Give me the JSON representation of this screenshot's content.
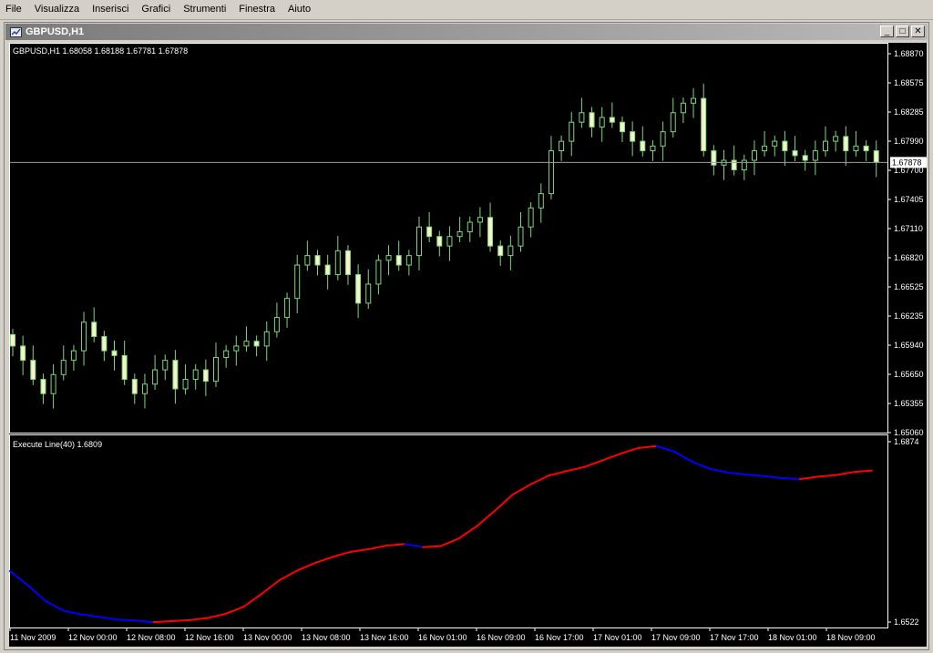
{
  "menu": [
    "File",
    "Visualizza",
    "Inserisci",
    "Grafici",
    "Strumenti",
    "Finestra",
    "Aiuto"
  ],
  "window": {
    "title": "GBPUSD,H1",
    "buttons": {
      "minimize": "_",
      "maximize": "□",
      "close": "✕"
    }
  },
  "chart_data": [
    {
      "type": "candlestick",
      "title": "GBPUSD,H1 1.68058 1.68188 1.67781 1.67878",
      "symbol": "GBPUSD,H1",
      "ohlc_label": "1.68058 1.68188 1.67781 1.67878",
      "ylim": [
        1.6506,
        1.69
      ],
      "y_ticks": [
        "1.68870",
        "1.68575",
        "1.68285",
        "1.67990",
        "1.67700",
        "1.67405",
        "1.67110",
        "1.66820",
        "1.66525",
        "1.66235",
        "1.65940",
        "1.65650",
        "1.65355",
        "1.65060"
      ],
      "current_price": "1.67878",
      "current_price_value": 1.67878,
      "grid": false,
      "colors": {
        "background": "#000000",
        "candle": "#7fd67f",
        "bull_body": "#000000",
        "bear_body": "#f4f4c8",
        "axis": "#ffffff",
        "price_line": "#a0a0a0"
      },
      "x_ticks": [
        "11 Nov 2009",
        "12 Nov 00:00",
        "12 Nov 08:00",
        "12 Nov 16:00",
        "13 Nov 00:00",
        "13 Nov 08:00",
        "13 Nov 16:00",
        "16 Nov 01:00",
        "16 Nov 09:00",
        "16 Nov 17:00",
        "17 Nov 01:00",
        "17 Nov 09:00",
        "17 Nov 17:00",
        "18 Nov 01:00",
        "18 Nov 09:00"
      ],
      "closes": [
        1.6595,
        1.658,
        1.656,
        1.6545,
        1.6565,
        1.658,
        1.659,
        1.662,
        1.6605,
        1.659,
        1.6585,
        1.656,
        1.6545,
        1.6555,
        1.657,
        1.658,
        1.655,
        1.656,
        1.657,
        1.6558,
        1.6583,
        1.659,
        1.6595,
        1.66,
        1.6595,
        1.661,
        1.6625,
        1.6645,
        1.668,
        1.669,
        1.668,
        1.667,
        1.6695,
        1.667,
        1.664,
        1.666,
        1.6685,
        1.669,
        1.668,
        1.669,
        1.672,
        1.671,
        1.67,
        1.671,
        1.6715,
        1.6725,
        1.673,
        1.67,
        1.669,
        1.67,
        1.672,
        1.674,
        1.6755,
        1.68,
        1.681,
        1.683,
        1.684,
        1.6825,
        1.6835,
        1.683,
        1.682,
        1.681,
        1.68,
        1.6805,
        1.682,
        1.684,
        1.685,
        1.6855,
        1.68,
        1.6785,
        1.679,
        1.678,
        1.679,
        1.68,
        1.6805,
        1.681,
        1.68,
        1.6795,
        1.679,
        1.68,
        1.681,
        1.6815,
        1.68,
        1.6805,
        1.68,
        1.6788
      ],
      "wick": 0.0012
    },
    {
      "type": "line",
      "title": "Execute Line(40) 1.6809",
      "indicator_name": "Execute Line(40)",
      "indicator_value": "1.6809",
      "ylim": [
        1.6518,
        1.6882
      ],
      "y_ticks": [
        "1.6874",
        "1.6522"
      ],
      "colors": {
        "rising": "#ff0000",
        "falling": "#0000ff"
      },
      "values": [
        1.6625,
        1.6597,
        1.6566,
        1.6547,
        1.654,
        1.6535,
        1.653,
        1.6528,
        1.6525,
        1.6527,
        1.6529,
        1.6533,
        1.6541,
        1.6555,
        1.658,
        1.6607,
        1.6626,
        1.6641,
        1.6653,
        1.6663,
        1.6668,
        1.6675,
        1.6678,
        1.6672,
        1.6674,
        1.6689,
        1.6713,
        1.6743,
        1.6775,
        1.6795,
        1.6812,
        1.6821,
        1.6829,
        1.6842,
        1.6855,
        1.6866,
        1.687,
        1.6859,
        1.6839,
        1.6825,
        1.6818,
        1.6814,
        1.6811,
        1.6807,
        1.6805,
        1.681,
        1.6813,
        1.6819,
        1.6822
      ]
    }
  ]
}
